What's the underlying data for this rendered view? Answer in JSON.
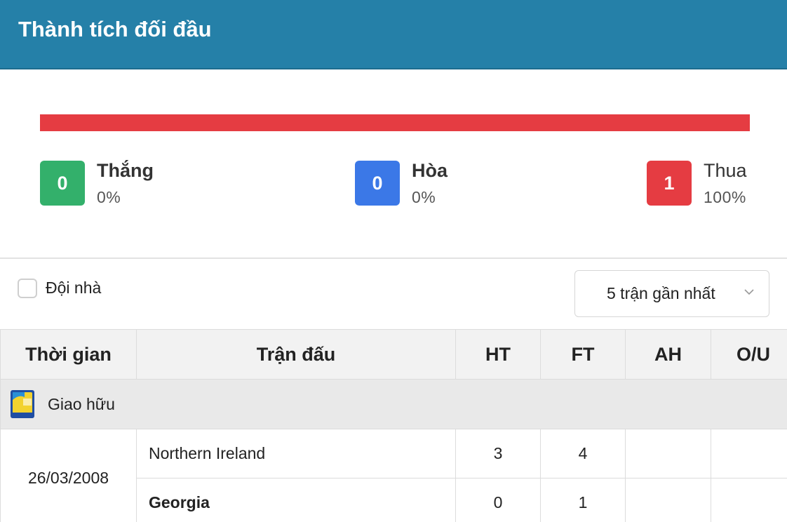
{
  "header": {
    "title": "Thành tích đối đầu"
  },
  "summary": {
    "win": {
      "count": "0",
      "label": "Thắng",
      "percent": "0%",
      "color": "#33b06b"
    },
    "draw": {
      "count": "0",
      "label": "Hòa",
      "percent": "0%",
      "color": "#3b78e7"
    },
    "lose": {
      "count": "1",
      "label": "Thua",
      "percent": "100%",
      "color": "#e53c42"
    }
  },
  "filters": {
    "home_only_label": "Đội nhà",
    "home_only_checked": false,
    "range_select": {
      "selected": "5 trận gần nhất"
    }
  },
  "table": {
    "columns": [
      "Thời gian",
      "Trận đấu",
      "HT",
      "FT",
      "AH",
      "O/U"
    ],
    "groups": [
      {
        "league": "Giao hữu",
        "league_icon": "fifa-friendly-logo",
        "matches": [
          {
            "date": "26/03/2008",
            "teams": [
              {
                "name": "Northern Ireland",
                "ht": "3",
                "ft": "4",
                "ah": "",
                "ou": "",
                "bold": false
              },
              {
                "name": "Georgia",
                "ht": "0",
                "ft": "1",
                "ah": "",
                "ou": "",
                "bold": true
              }
            ]
          }
        ]
      }
    ]
  }
}
